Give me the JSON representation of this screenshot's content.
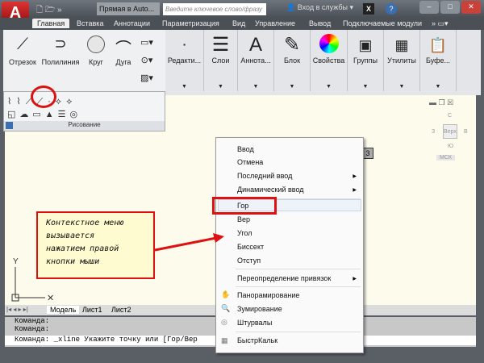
{
  "title": {
    "app_logo": "A",
    "doc_title": "Прямая в Auto...",
    "search_placeholder": "Введите ключевое слово/фразу",
    "login": "Вход в службы"
  },
  "tabs": [
    "Главная",
    "Вставка",
    "Аннотации",
    "Параметризация",
    "Вид",
    "Управление",
    "Вывод",
    "Подключаемые модули"
  ],
  "draw_tools": [
    "Отрезок",
    "Полилиния",
    "Круг",
    "Дуга"
  ],
  "panels": [
    "Редакти...",
    "Слои",
    "Аннота...",
    "Блок",
    "Свойства",
    "Группы",
    "Утилиты",
    "Буфе..."
  ],
  "draw_panel_title": "Рисование",
  "viewcube": {
    "n": "С",
    "w": "З",
    "e": "В",
    "s": "Ю",
    "top": "Верх",
    "ucs": "МСК"
  },
  "layout_tabs": [
    "Модель",
    "Лист1",
    "Лист2"
  ],
  "command_lines": [
    "Команда:",
    "Команда:",
    "Команда: _xline Укажите точку или [Гор/Вер"
  ],
  "context_menu": {
    "items": [
      "Ввод",
      "Отмена",
      "Последний ввод",
      "Динамический ввод",
      "Гор",
      "Вер",
      "Угол",
      "Биссект",
      "Отступ",
      "Переопределение привязок",
      "Панорамирование",
      "Зумирование",
      "Штурвалы",
      "БыстрКальк"
    ],
    "highlighted": "Гор"
  },
  "callout": [
    "Контекстное меню",
    "вызывается",
    "нажатием правой",
    "кнопки мыши"
  ],
  "tooltip_fragment": "3",
  "colors": {
    "accent": "#dd1111",
    "drawing_bg": "#fdfbeb"
  }
}
